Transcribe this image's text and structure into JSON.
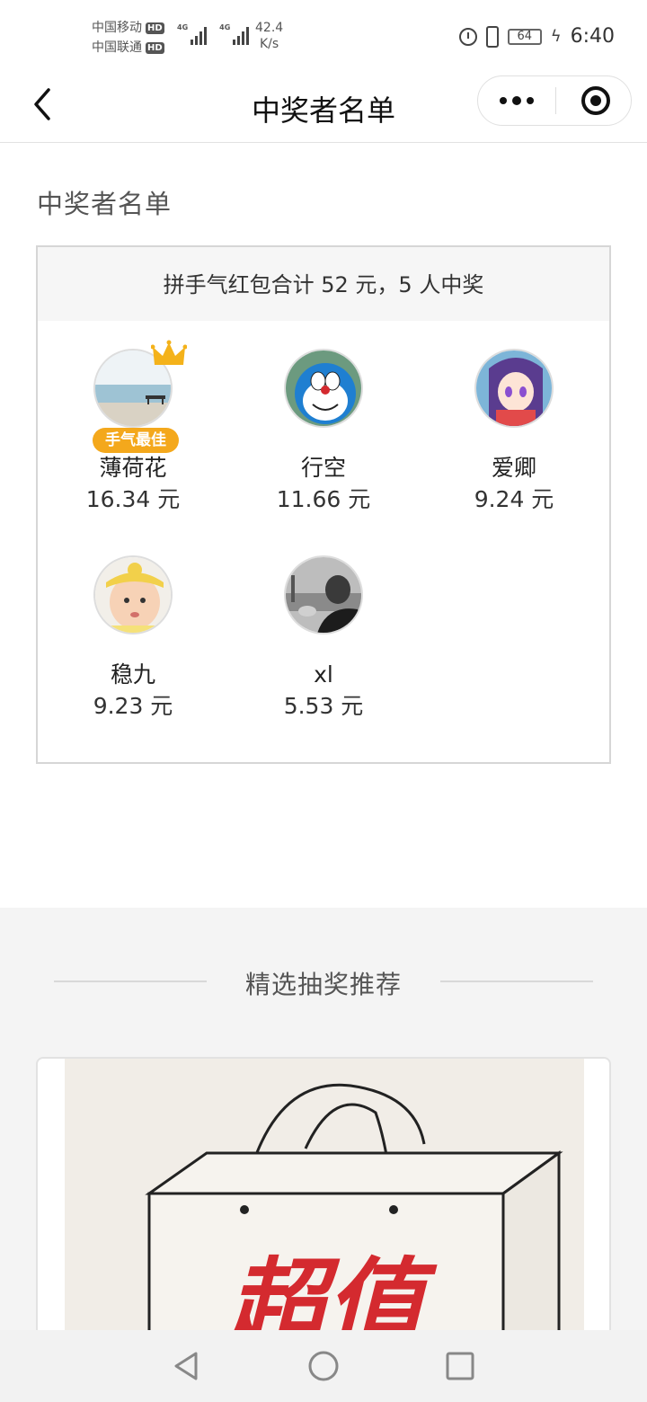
{
  "status_bar": {
    "carrier1": "中国移动",
    "carrier2": "中国联通",
    "hd": "HD",
    "net1": "4G",
    "net2": "4G",
    "speed_value": "42.4",
    "speed_unit": "K/s",
    "battery": "64",
    "time": "6:40"
  },
  "nav": {
    "title": "中奖者名单",
    "icons": [
      "back-arrow-icon",
      "more-dots-icon",
      "close-circle-icon"
    ]
  },
  "section_title": "中奖者名单",
  "summary": "拼手气红包合计 52 元，5 人中奖",
  "best_badge": "手气最佳",
  "winners": [
    {
      "name": "薄荷花",
      "amount": "16.34 元"
    },
    {
      "name": "行空",
      "amount": "11.66 元"
    },
    {
      "name": "爱卿",
      "amount": "9.24 元"
    },
    {
      "name": "稳九",
      "amount": "9.23 元"
    },
    {
      "name": "xl",
      "amount": "5.53 元"
    }
  ],
  "recommend": {
    "title": "精选抽奖推荐",
    "banner_text": "超值"
  },
  "system_nav": {
    "icons": [
      "back-triangle-icon",
      "home-circle-icon",
      "recents-square-icon"
    ]
  },
  "colors": {
    "badge": "#f4a81c",
    "banner_text": "#d42a2f",
    "gray_bg": "#f4f4f4"
  }
}
